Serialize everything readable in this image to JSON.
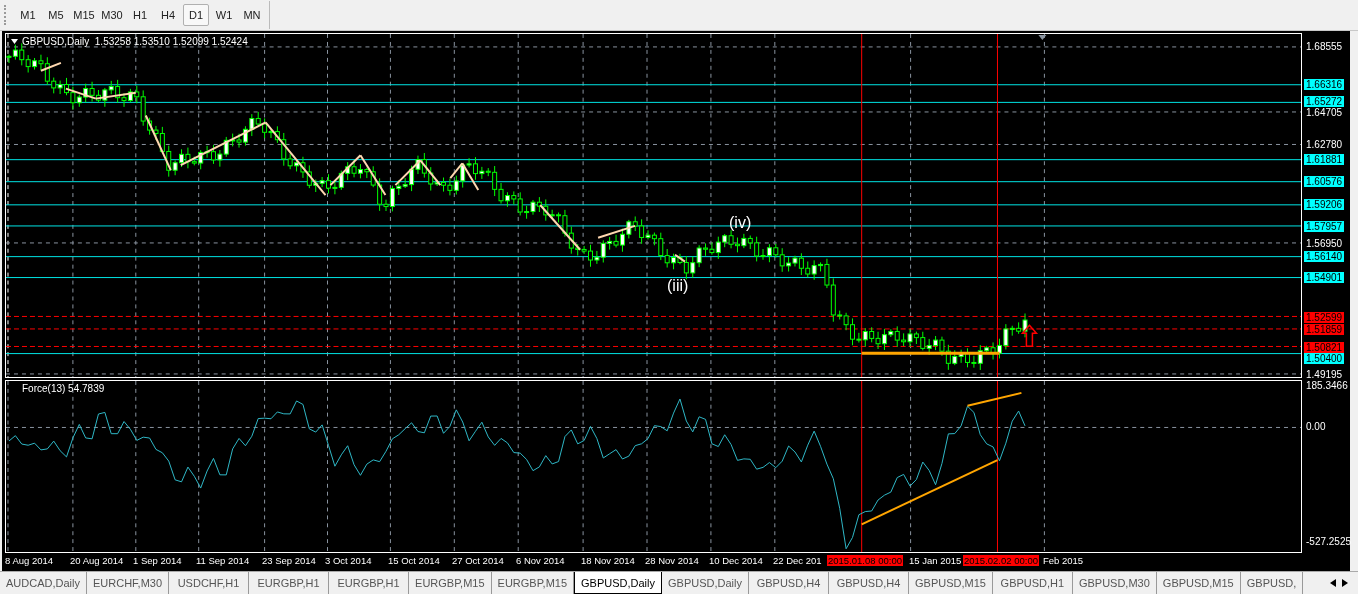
{
  "timeframes": [
    {
      "label": "M1",
      "selected": false
    },
    {
      "label": "M5",
      "selected": false
    },
    {
      "label": "M15",
      "selected": false
    },
    {
      "label": "M30",
      "selected": false
    },
    {
      "label": "H1",
      "selected": false
    },
    {
      "label": "H4",
      "selected": false
    },
    {
      "label": "D1",
      "selected": true
    },
    {
      "label": "W1",
      "selected": false
    },
    {
      "label": "MN",
      "selected": false
    }
  ],
  "chart": {
    "symbol": "GBPUSD,Daily",
    "quotes": "1.53258 1.53510 1.52099 1.52424",
    "price_labels": [
      {
        "text": "1.68555",
        "kind": "grid"
      },
      {
        "text": "1.66316",
        "kind": "level"
      },
      {
        "text": "1.65272",
        "kind": "level"
      },
      {
        "text": "1.64705",
        "kind": "grid"
      },
      {
        "text": "1.62780",
        "kind": "grid"
      },
      {
        "text": "1.61881",
        "kind": "level"
      },
      {
        "text": "1.60576",
        "kind": "level"
      },
      {
        "text": "1.59206",
        "kind": "level"
      },
      {
        "text": "1.57957",
        "kind": "level"
      },
      {
        "text": "1.56950",
        "kind": "grid"
      },
      {
        "text": "1.56140",
        "kind": "level"
      },
      {
        "text": "1.54901",
        "kind": "level"
      },
      {
        "text": "1.52599",
        "kind": "stop"
      },
      {
        "text": "1.51859",
        "kind": "stop"
      },
      {
        "text": "1.50821",
        "kind": "stop"
      },
      {
        "text": "1.50400",
        "kind": "level"
      },
      {
        "text": "1.49195",
        "kind": "grid"
      }
    ],
    "annotations": [
      {
        "text": "(iv)"
      },
      {
        "text": "(iii)"
      }
    ],
    "indicator": {
      "label": "Force(13) 54.7839",
      "axis": [
        "185.3466",
        "0.00",
        "-527.2525"
      ]
    },
    "dates": [
      "8 Aug 2014",
      "20 Aug 2014",
      "1 Sep 2014",
      "11 Sep 2014",
      "23 Sep 2014",
      "3 Oct 2014",
      "15 Oct 2014",
      "27 Oct 2014",
      "6 Nov 2014",
      "18 Nov 2014",
      "28 Nov 2014",
      "10 Dec 2014",
      "22 Dec 201",
      "15 Jan 2015",
      "Feb 2015"
    ],
    "markers": [
      {
        "label": "2015.01.08 00:00"
      },
      {
        "label": "2015.02.02 00:00"
      }
    ]
  },
  "tabs": [
    {
      "label": "AUDCAD,Daily",
      "selected": false
    },
    {
      "label": "EURCHF,M30",
      "selected": false
    },
    {
      "label": "USDCHF,H1",
      "selected": false
    },
    {
      "label": "EURGBP,H1",
      "selected": false
    },
    {
      "label": "EURGBP,H1",
      "selected": false
    },
    {
      "label": "EURGBP,M15",
      "selected": false
    },
    {
      "label": "EURGBP,M15",
      "selected": false
    },
    {
      "label": "GBPUSD,Daily",
      "selected": true
    },
    {
      "label": "GBPUSD,Daily",
      "selected": false
    },
    {
      "label": "GBPUSD,H4",
      "selected": false
    },
    {
      "label": "GBPUSD,H4",
      "selected": false
    },
    {
      "label": "GBPUSD,M15",
      "selected": false
    },
    {
      "label": "GBPUSD,H1",
      "selected": false
    },
    {
      "label": "GBPUSD,M30",
      "selected": false
    },
    {
      "label": "GBPUSD,M15",
      "selected": false
    },
    {
      "label": "GBPUSD,",
      "selected": false
    }
  ]
}
